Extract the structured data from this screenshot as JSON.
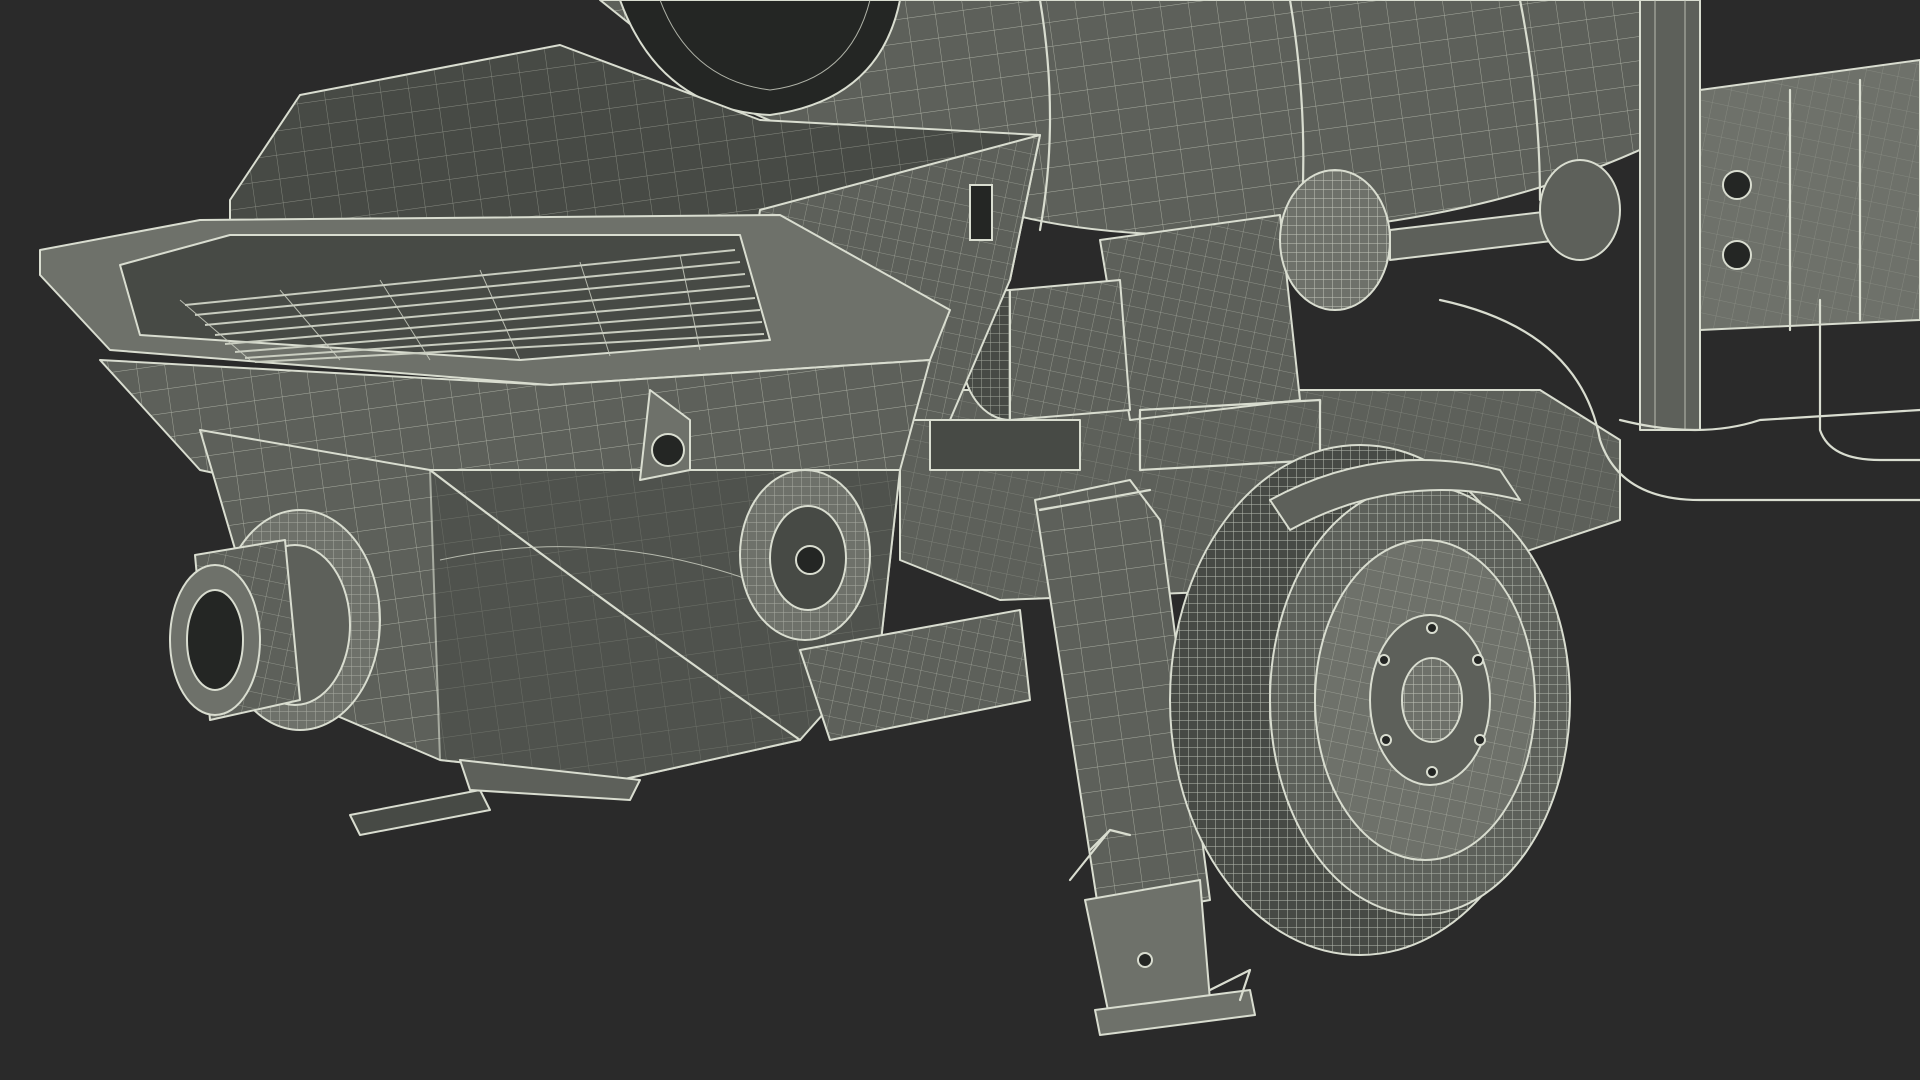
{
  "scene": {
    "subject": "wireframe-render",
    "colors": {
      "background": "#2a2a2a",
      "surface": "#5d605a",
      "surface_dark": "#474a45",
      "wire": "#d9ddd0"
    }
  }
}
